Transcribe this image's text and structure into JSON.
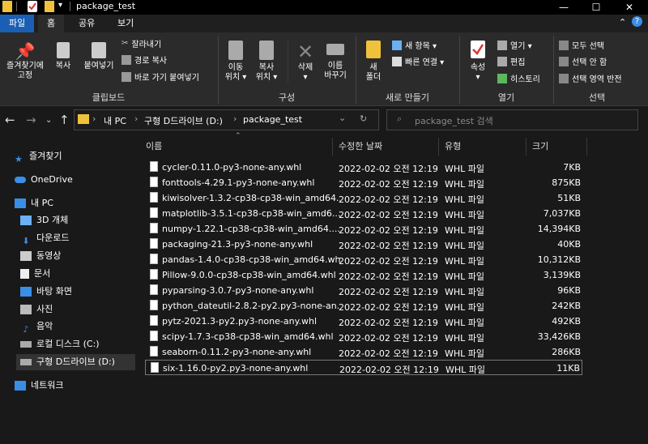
{
  "window": {
    "title": "package_test",
    "minimize": "—",
    "maximize": "☐",
    "close": "✕"
  },
  "tabs": [
    {
      "label": "파일"
    },
    {
      "label": "홈"
    },
    {
      "label": "공유"
    },
    {
      "label": "보기"
    }
  ],
  "ribbon": {
    "clipboard": {
      "pin_label_1": "즐겨찾기에",
      "pin_label_2": "고정",
      "copy": "복사",
      "paste": "붙여넣기",
      "cut": "잘라내기",
      "copy_path": "경로 복사",
      "paste_shortcut": "바로 가기 붙여넣기",
      "group": "클립보드"
    },
    "organize": {
      "move_1": "이동",
      "move_2": "위치 ▾",
      "copyto_1": "복사",
      "copyto_2": "위치 ▾",
      "delete_1": "삭제",
      "delete_2": "▾",
      "rename_1": "이름",
      "rename_2": "바꾸기",
      "group": "구성"
    },
    "new": {
      "folder_1": "새",
      "folder_2": "폴더",
      "new_item": "새 항목 ▾",
      "easy_access": "빠른 연결 ▾",
      "group": "새로 만들기"
    },
    "open": {
      "props_1": "속성",
      "props_2": "▾",
      "open": "열기 ▾",
      "edit": "편집",
      "history": "히스토리",
      "group": "열기"
    },
    "select": {
      "all": "모두 선택",
      "none": "선택 안 함",
      "invert": "선택 영역 반전",
      "group": "선택"
    }
  },
  "address": {
    "crumb_pc": "내 PC",
    "crumb_drive": "구형 D드라이브 (D:)",
    "crumb_folder": "package_test",
    "search_placeholder": "package_test 검색"
  },
  "nav": [
    {
      "label": "즐겨찾기"
    },
    {
      "label": "OneDrive"
    },
    {
      "label": "내 PC"
    },
    {
      "label": "3D 개체"
    },
    {
      "label": "다운로드"
    },
    {
      "label": "동영상"
    },
    {
      "label": "문서"
    },
    {
      "label": "바탕 화면"
    },
    {
      "label": "사진"
    },
    {
      "label": "음악"
    },
    {
      "label": "로컬 디스크 (C:)"
    },
    {
      "label": "구형 D드라이브 (D:)"
    },
    {
      "label": "네트워크"
    }
  ],
  "columns": {
    "name": "이름",
    "modified": "수정한 날짜",
    "type": "유형",
    "size": "크기"
  },
  "files": [
    {
      "name": "cycler-0.11.0-py3-none-any.whl",
      "date": "2022-02-02 오전 12:19",
      "type": "WHL 파일",
      "size": "7KB"
    },
    {
      "name": "fonttools-4.29.1-py3-none-any.whl",
      "date": "2022-02-02 오전 12:19",
      "type": "WHL 파일",
      "size": "875KB"
    },
    {
      "name": "kiwisolver-1.3.2-cp38-cp38-win_amd64....",
      "date": "2022-02-02 오전 12:19",
      "type": "WHL 파일",
      "size": "51KB"
    },
    {
      "name": "matplotlib-3.5.1-cp38-cp38-win_amd6...",
      "date": "2022-02-02 오전 12:19",
      "type": "WHL 파일",
      "size": "7,037KB"
    },
    {
      "name": "numpy-1.22.1-cp38-cp38-win_amd64....",
      "date": "2022-02-02 오전 12:19",
      "type": "WHL 파일",
      "size": "14,394KB"
    },
    {
      "name": "packaging-21.3-py3-none-any.whl",
      "date": "2022-02-02 오전 12:19",
      "type": "WHL 파일",
      "size": "40KB"
    },
    {
      "name": "pandas-1.4.0-cp38-cp38-win_amd64.whl",
      "date": "2022-02-02 오전 12:19",
      "type": "WHL 파일",
      "size": "10,312KB"
    },
    {
      "name": "Pillow-9.0.0-cp38-cp38-win_amd64.whl",
      "date": "2022-02-02 오전 12:19",
      "type": "WHL 파일",
      "size": "3,139KB"
    },
    {
      "name": "pyparsing-3.0.7-py3-none-any.whl",
      "date": "2022-02-02 오전 12:19",
      "type": "WHL 파일",
      "size": "96KB"
    },
    {
      "name": "python_dateutil-2.8.2-py2.py3-none-an...",
      "date": "2022-02-02 오전 12:19",
      "type": "WHL 파일",
      "size": "242KB"
    },
    {
      "name": "pytz-2021.3-py2.py3-none-any.whl",
      "date": "2022-02-02 오전 12:19",
      "type": "WHL 파일",
      "size": "492KB"
    },
    {
      "name": "scipy-1.7.3-cp38-cp38-win_amd64.whl",
      "date": "2022-02-02 오전 12:19",
      "type": "WHL 파일",
      "size": "33,426KB"
    },
    {
      "name": "seaborn-0.11.2-py3-none-any.whl",
      "date": "2022-02-02 오전 12:19",
      "type": "WHL 파일",
      "size": "286KB"
    },
    {
      "name": "six-1.16.0-py2.py3-none-any.whl",
      "date": "2022-02-02 오전 12:19",
      "type": "WHL 파일",
      "size": "11KB"
    }
  ],
  "colors": {
    "background": "#191919",
    "ribbon": "#2b2b2b",
    "folder": "#f0c23b",
    "accent": "#3a8ee6"
  }
}
